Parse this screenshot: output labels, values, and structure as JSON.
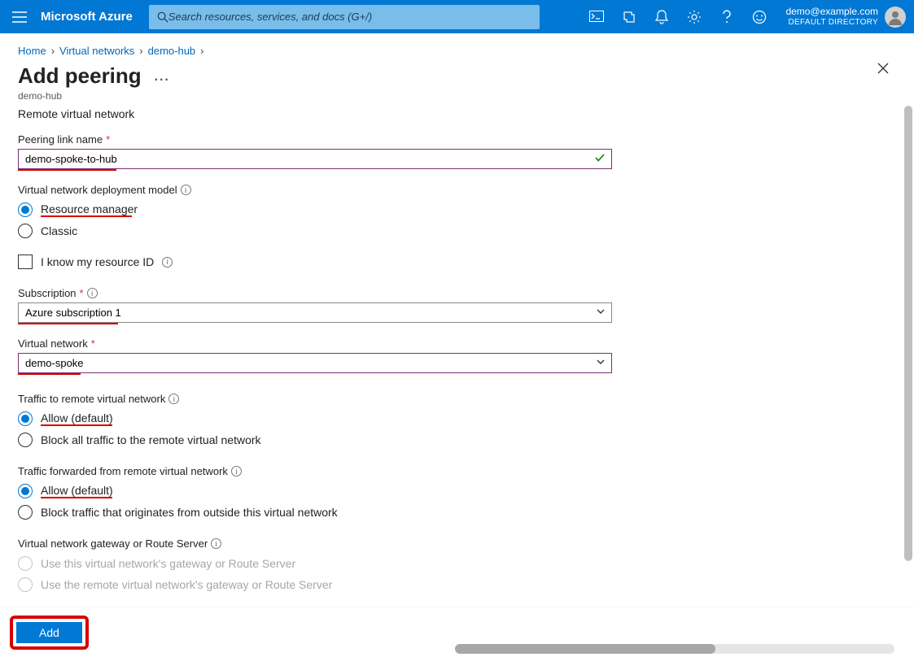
{
  "topbar": {
    "brand": "Microsoft Azure",
    "search_placeholder": "Search resources, services, and docs (G+/)",
    "account_email": "demo@example.com",
    "account_directory": "DEFAULT DIRECTORY"
  },
  "breadcrumb": {
    "items": [
      "Home",
      "Virtual networks",
      "demo-hub"
    ]
  },
  "page": {
    "title": "Add peering",
    "subtitle": "demo-hub"
  },
  "form": {
    "section_remote": "Remote virtual network",
    "peering_link_name": {
      "label": "Peering link name",
      "value": "demo-spoke-to-hub",
      "underline_width": 121
    },
    "deployment_model": {
      "label": "Virtual network deployment model",
      "options": [
        "Resource manager",
        "Classic"
      ],
      "selected": 0,
      "underline_widths": [
        112,
        0
      ]
    },
    "know_resource_id": {
      "label": "I know my resource ID"
    },
    "subscription": {
      "label": "Subscription",
      "value": "Azure subscription 1",
      "underline_width": 123
    },
    "virtual_network": {
      "label": "Virtual network",
      "value": "demo-spoke",
      "underline_width": 77
    },
    "traffic_to_remote": {
      "label": "Traffic to remote virtual network",
      "options": [
        "Allow (default)",
        "Block all traffic to the remote virtual network"
      ],
      "selected": 0,
      "underline_widths": [
        88,
        0
      ]
    },
    "traffic_forwarded": {
      "label": "Traffic forwarded from remote virtual network",
      "options": [
        "Allow (default)",
        "Block traffic that originates from outside this virtual network"
      ],
      "selected": 0,
      "underline_widths": [
        88,
        0
      ]
    },
    "gateway": {
      "label": "Virtual network gateway or Route Server",
      "options": [
        "Use this virtual network's gateway or Route Server",
        "Use the remote virtual network's gateway or Route Server"
      ],
      "disabled": true
    }
  },
  "footer": {
    "add_label": "Add"
  }
}
